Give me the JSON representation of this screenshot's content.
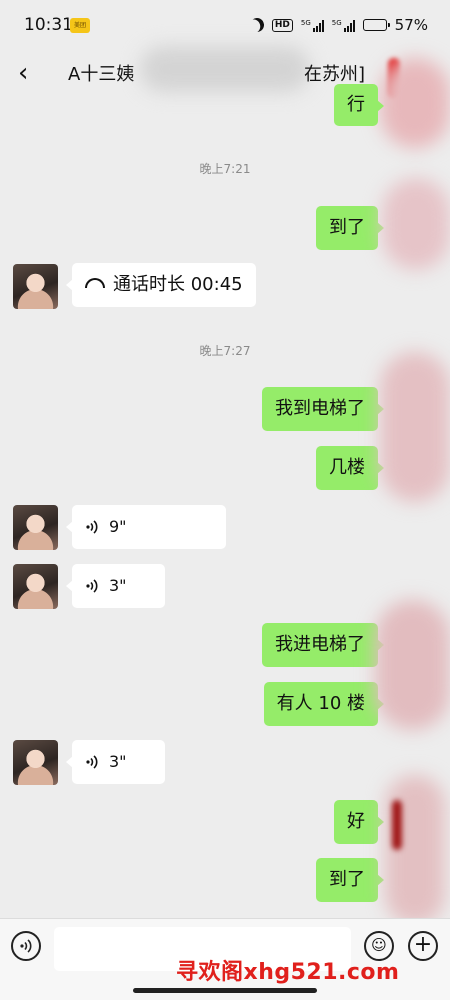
{
  "status_bar": {
    "time": "10:31",
    "app_badge": "美团",
    "hd": "HD",
    "network1": "5G",
    "network2": "5G",
    "battery_pct": "57%",
    "battery_level": 0.57
  },
  "header": {
    "back_icon": "chevron-left-icon",
    "title_prefix": "A十三姨",
    "title_suffix": "在苏州]"
  },
  "messages": [
    {
      "type": "text",
      "dir": "out",
      "text": "行"
    },
    {
      "type": "timestamp",
      "text": "晚上7:21"
    },
    {
      "type": "text",
      "dir": "out",
      "text": "到了"
    },
    {
      "type": "call",
      "dir": "in",
      "text": "通话时长 00:45"
    },
    {
      "type": "timestamp",
      "text": "晚上7:27"
    },
    {
      "type": "text",
      "dir": "out",
      "text": "我到电梯了"
    },
    {
      "type": "text",
      "dir": "out",
      "text": "几楼"
    },
    {
      "type": "voice",
      "dir": "in",
      "duration": "9\""
    },
    {
      "type": "voice",
      "dir": "in",
      "duration": "3\""
    },
    {
      "type": "text",
      "dir": "out",
      "text": "我进电梯了"
    },
    {
      "type": "text",
      "dir": "out",
      "text": "有人 10 楼"
    },
    {
      "type": "voice",
      "dir": "in",
      "duration": "3\""
    },
    {
      "type": "text",
      "dir": "out",
      "text": "好"
    },
    {
      "type": "text",
      "dir": "out",
      "text": "到了"
    }
  ],
  "input_bar": {
    "placeholder": ""
  },
  "watermark": "寻欢阁xhg521.com"
}
